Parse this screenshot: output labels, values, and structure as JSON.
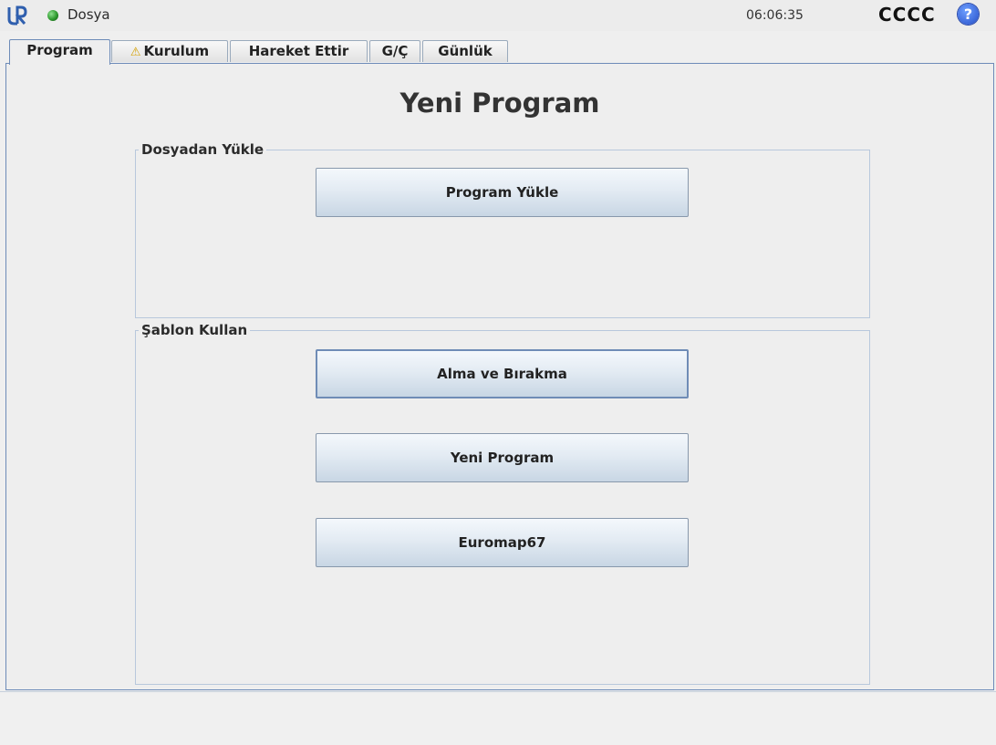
{
  "topbar": {
    "logo": "ur-logo",
    "status_color": "#2e9a2e",
    "file_label": "Dosya",
    "time": "06:06:35",
    "robot_name": "CCCC",
    "help_label": "?"
  },
  "tabs": [
    {
      "label": "Program",
      "active": true
    },
    {
      "label": "Kurulum",
      "icon": "warning-icon",
      "warning": "⚠"
    },
    {
      "label": "Hareket Ettir"
    },
    {
      "label": "G/Ç"
    },
    {
      "label": "Günlük"
    }
  ],
  "main": {
    "title": "Yeni Program",
    "load_group": {
      "legend": "Dosyadan Yükle",
      "button": "Program Yükle"
    },
    "template_group": {
      "legend": "Şablon Kullan",
      "buttons": [
        "Alma ve Bırakma",
        "Yeni Program",
        "Euromap67"
      ]
    }
  },
  "colors": {
    "accent_border": "#6d8bb8",
    "button_top": "#f4f8fc",
    "button_bottom": "#c8d6e4",
    "background": "#efefef"
  }
}
